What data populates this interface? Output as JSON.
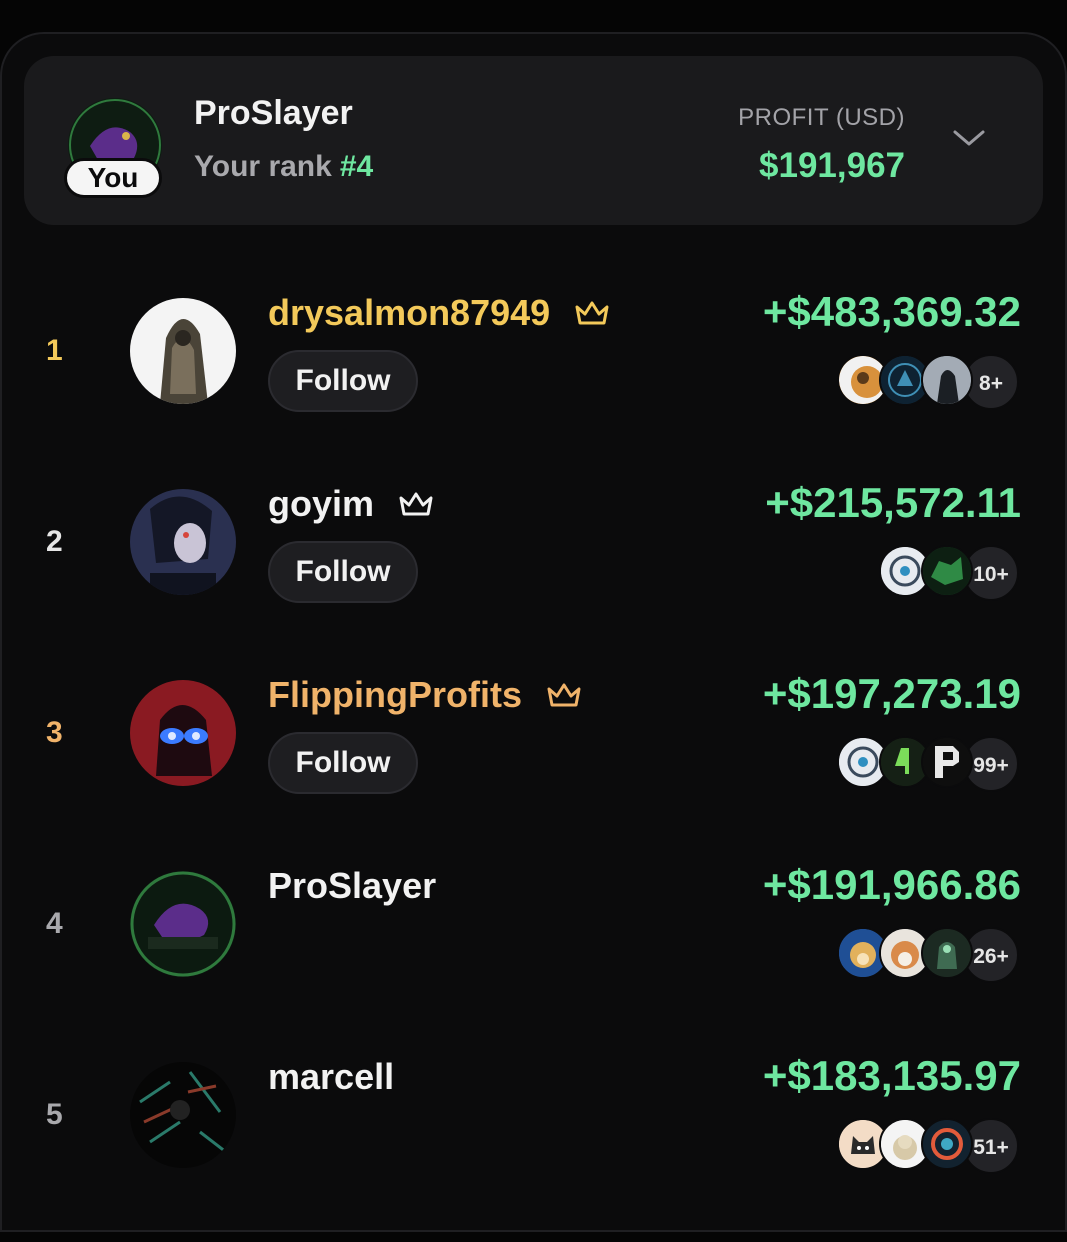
{
  "me": {
    "name": "ProSlayer",
    "badge": "You",
    "rank_label": "Your rank",
    "rank": "#4",
    "profit_label": "PROFIT (USD)",
    "profit": "$191,967"
  },
  "colors": {
    "accent_green": "#6ee7a0",
    "gold": "#f3c95a",
    "orange": "#f0b36a"
  },
  "follow_label": "Follow",
  "rows": [
    {
      "rank": "1",
      "name": "drysalmon87949",
      "profit": "+$483,369.32",
      "more": "8+",
      "crown": true,
      "follow": true
    },
    {
      "rank": "2",
      "name": "goyim",
      "profit": "+$215,572.11",
      "more": "10+",
      "crown": true,
      "follow": true
    },
    {
      "rank": "3",
      "name": "FlippingProfits",
      "profit": "+$197,273.19",
      "more": "99+",
      "crown": true,
      "follow": true
    },
    {
      "rank": "4",
      "name": "ProSlayer",
      "profit": "+$191,966.86",
      "more": "26+",
      "crown": false,
      "follow": false
    },
    {
      "rank": "5",
      "name": "marcell",
      "profit": "+$183,135.97",
      "more": "51+",
      "crown": false,
      "follow": false
    }
  ]
}
